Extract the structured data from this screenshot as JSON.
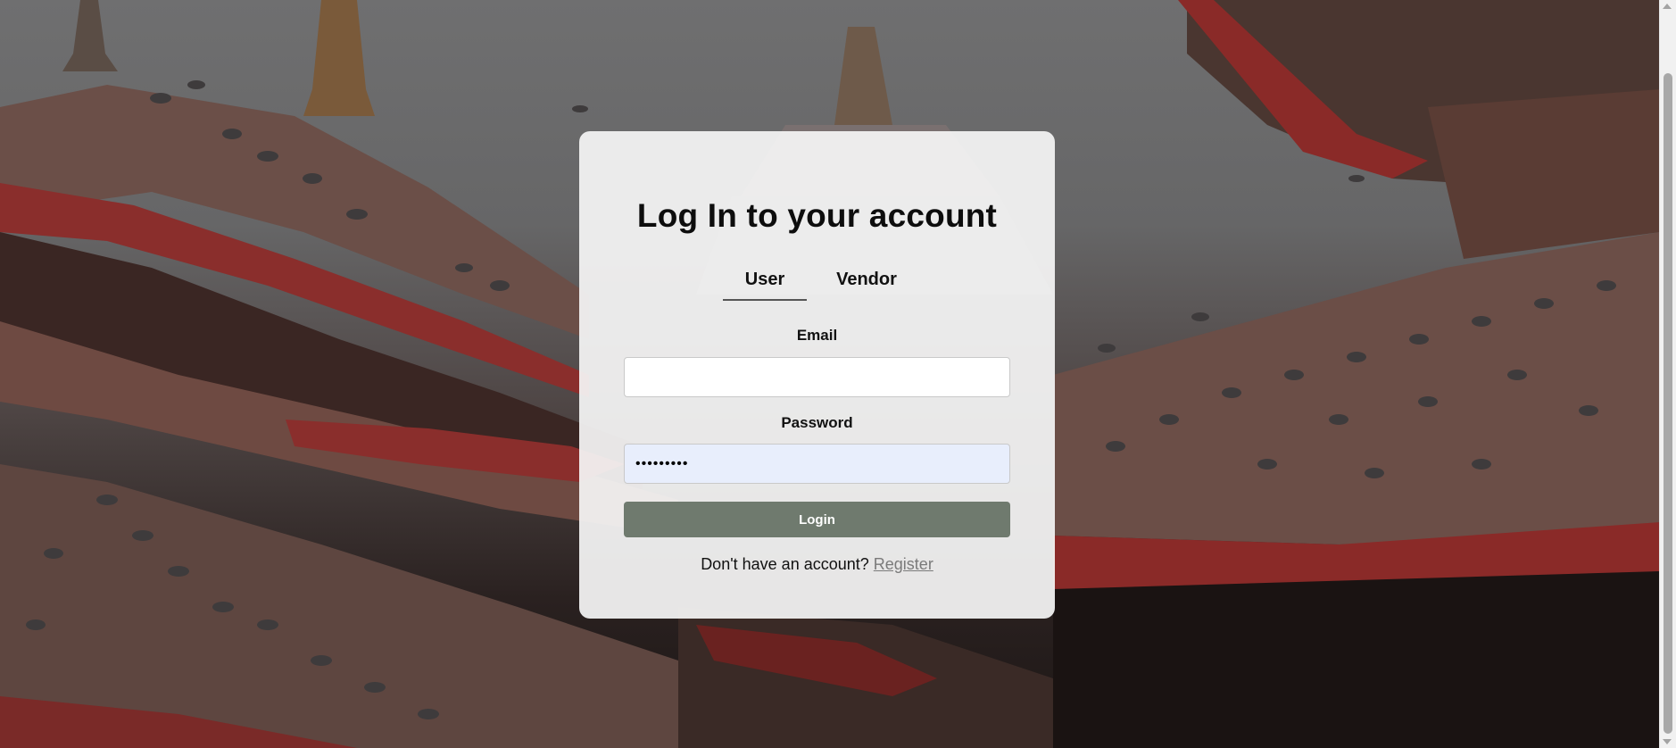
{
  "login": {
    "title": "Log In to your account",
    "tabs": [
      {
        "label": "User",
        "active": true
      },
      {
        "label": "Vendor",
        "active": false
      }
    ],
    "email_label": "Email",
    "email_value": "",
    "password_label": "Password",
    "password_value": "•••••••••",
    "login_button": "Login",
    "register_prompt": "Don't have an account?",
    "register_link": "Register"
  },
  "colors": {
    "card_background": "#f5f5f5",
    "login_button": "#6f7a6e",
    "password_autofill": "#e8eefc",
    "register_link": "#7a7a7a"
  },
  "icons": {
    "scroll_up": "triangle-up",
    "scroll_down": "triangle-down"
  }
}
